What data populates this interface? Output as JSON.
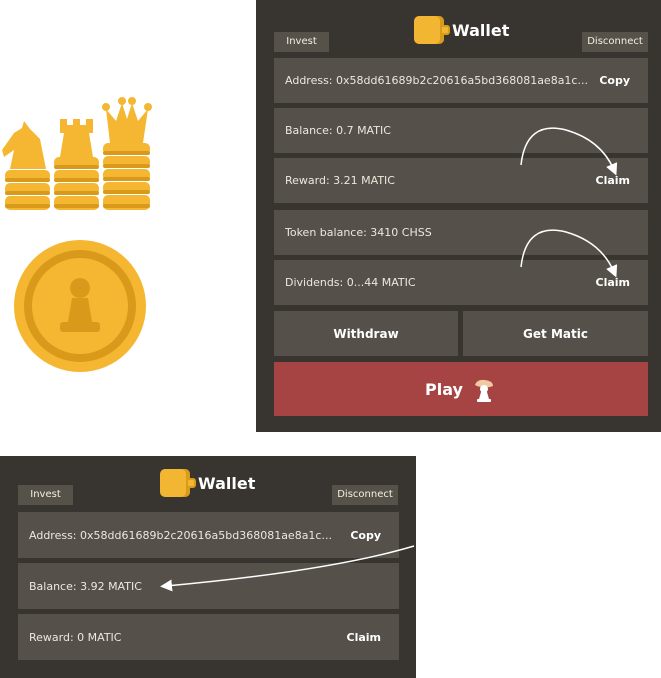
{
  "wallet_top": {
    "title": "Wallet",
    "invest_label": "Invest",
    "disconnect_label": "Disconnect",
    "address_text": "Address:  0x58dd61689b2c20616a5bd368081ae8a1c...",
    "copy_label": "Copy",
    "balance_text": "Balance: 0.7 MATIC",
    "reward_text": "Reward: 3.21 MATIC",
    "reward_claim_label": "Claim",
    "token_balance_text": "Token balance:  3410 CHSS",
    "dividends_text": "Dividends:  0...44 MATIC",
    "dividends_claim_label": "Claim",
    "withdraw_label": "Withdraw",
    "get_matic_label": "Get Matic",
    "play_label": "Play"
  },
  "wallet_bottom": {
    "title": "Wallet",
    "invest_label": "Invest",
    "disconnect_label": "Disconnect",
    "address_text": "Address:  0x58dd61689b2c20616a5bd368081ae8a1c...",
    "copy_label": "Copy",
    "balance_text": "Balance: 3.92 MATIC",
    "reward_text": "Reward: 0 MATIC",
    "reward_claim_label": "Claim"
  },
  "colors": {
    "panel_bg": "#38342f",
    "row_bg": "#55514a",
    "play_bg": "#a64343",
    "gold": "#f2b632"
  },
  "icons": [
    "wallet-icon",
    "chess-pieces-icon",
    "pawn-coin-icon",
    "hand-pawn-icon"
  ]
}
